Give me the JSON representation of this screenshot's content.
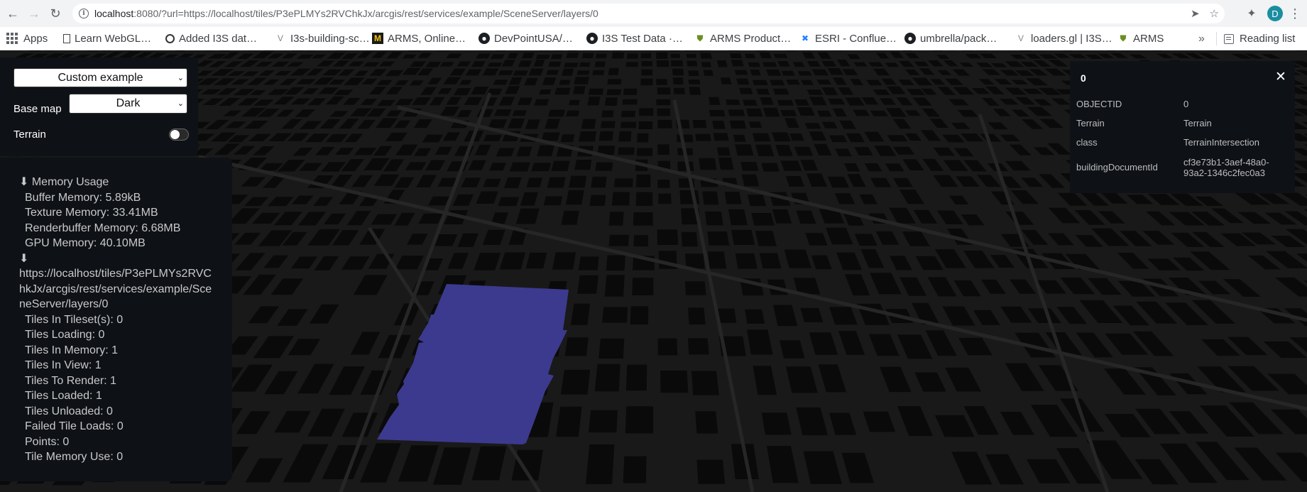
{
  "browser": {
    "url_host": "localhost",
    "url_rest": ":8080/?url=https://localhost/tiles/P3ePLMYs2RVChkJx/arcgis/rest/services/example/SceneServer/layers/0",
    "profile_initial": "D",
    "bookmarks": [
      {
        "label": "Apps",
        "icon": "apps-icon"
      },
      {
        "label": "Learn WebGL…",
        "icon": "page-icon"
      },
      {
        "label": "Added I3S dat…",
        "icon": "circle-ci-icon"
      },
      {
        "label": "I3s-building-sc…",
        "icon": "v-icon"
      },
      {
        "label": "ARMS, Online…",
        "icon": "m-icon"
      },
      {
        "label": "DevPointUSA/…",
        "icon": "github-icon"
      },
      {
        "label": "I3S Test Data ·…",
        "icon": "github-icon"
      },
      {
        "label": "ARMS Product…",
        "icon": "shield-icon"
      },
      {
        "label": "ESRI - Conflue…",
        "icon": "x-icon"
      },
      {
        "label": "umbrella/pack…",
        "icon": "github-icon"
      },
      {
        "label": "loaders.gl | I3S…",
        "icon": "v-icon"
      },
      {
        "label": "ARMS",
        "icon": "shield-icon"
      }
    ],
    "reading_list": "Reading list"
  },
  "controls": {
    "example_select": "Custom example",
    "basemap_label": "Base map",
    "basemap_select": "Dark",
    "terrain_label": "Terrain",
    "terrain_enabled": false
  },
  "stats": {
    "memory_header": "⬇ Memory Usage",
    "memory": [
      "Buffer Memory: 5.89kB",
      "Texture Memory: 33.41MB",
      "Renderbuffer Memory: 6.68MB",
      "GPU Memory: 40.10MB"
    ],
    "tileset_arrow": "⬇",
    "tileset_url": "https://localhost/tiles/P3ePLMYs2RVChkJx/arcgis/rest/services/example/SceneServer/layers/0",
    "tiles": [
      "Tiles In Tileset(s): 0",
      "Tiles Loading: 0",
      "Tiles In Memory: 1",
      "Tiles In View: 1",
      "Tiles To Render: 1",
      "Tiles Loaded: 1",
      "Tiles Unloaded: 0",
      "Failed Tile Loads: 0",
      "Points: 0",
      "Tile Memory Use: 0"
    ]
  },
  "attributes": {
    "title": "0",
    "close_glyph": "✕",
    "rows": [
      {
        "key": "OBJECTID",
        "value": "0"
      },
      {
        "key": "Terrain",
        "value": "Terrain"
      },
      {
        "key": "class",
        "value": "TerrainIntersection"
      },
      {
        "key": "buildingDocumentId",
        "value": "cf3e73b1-3aef-48a0-93a2-1346c2fec0a3"
      }
    ]
  },
  "colors": {
    "map_bg": "#191919",
    "road": "#262626",
    "block": "#0a0a0a",
    "terrain_patch": "#3c3a8e",
    "panel_bg": "#0e1116"
  }
}
